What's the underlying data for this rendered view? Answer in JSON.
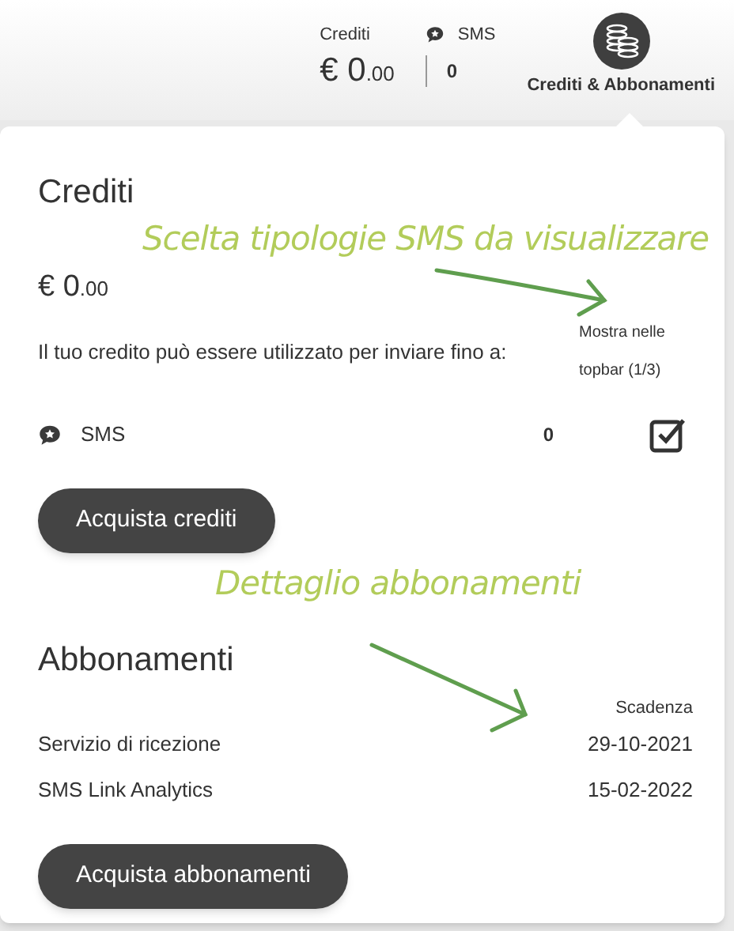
{
  "topbar": {
    "credits_label": "Crediti",
    "credits_amount": "€ 0",
    "credits_decimals": ".00",
    "sms_label": "SMS",
    "sms_count": "0",
    "menu_label": "Crediti & Abbonamenti"
  },
  "credits": {
    "title": "Crediti",
    "amount": "€ 0",
    "decimals": ".00",
    "description": "Il tuo credito può essere utilizzato per inviare fino a:",
    "show_header": "Mostra nelle topbar (1/3)",
    "items": [
      {
        "name": "SMS",
        "count": "0",
        "checked": true
      }
    ],
    "button": "Acquista crediti"
  },
  "subscriptions": {
    "title": "Abbonamenti",
    "column_header": "Scadenza",
    "rows": [
      {
        "name": "Servizio di ricezione",
        "expiry": "29-10-2021"
      },
      {
        "name": "SMS Link Analytics",
        "expiry": "15-02-2022"
      }
    ],
    "button": "Acquista abbonamenti"
  },
  "annotations": [
    "Scelta tipologie SMS da visualizzare",
    "Dettaglio abbonamenti"
  ]
}
